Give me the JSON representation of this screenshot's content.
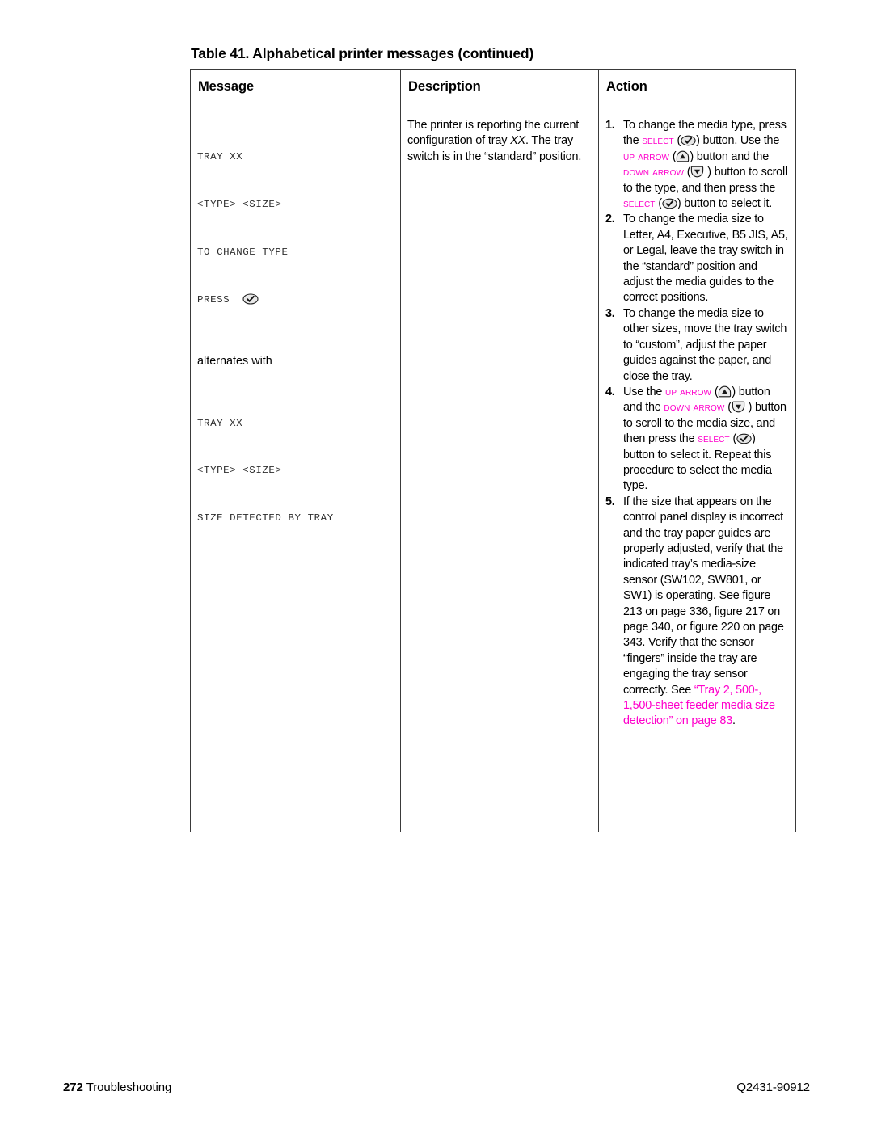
{
  "table": {
    "caption": "Table 41. Alphabetical printer messages (continued)",
    "headers": {
      "message": "Message",
      "description": "Description",
      "action": "Action"
    },
    "row": {
      "message": {
        "block1": [
          "TRAY XX",
          "<TYPE> <SIZE>",
          "TO CHANGE TYPE"
        ],
        "press_label": "PRESS",
        "alternates_label": "alternates with",
        "block2": [
          "TRAY XX",
          "<TYPE> <SIZE>",
          "SIZE DETECTED BY TRAY"
        ]
      },
      "description": {
        "part1": "The printer is reporting the current configuration of tray ",
        "tray_var": "XX",
        "part2": ". The tray switch is in the “standard” position."
      },
      "action": {
        "steps": [
          {
            "num": "1.",
            "seg": [
              "To change the media type, press the ",
              "Select",
              " (",
              "select-icon",
              ") button. Use the ",
              "Up Arrow",
              " (",
              "up-arrow-icon",
              ") button and the ",
              "Down Arrow",
              " (",
              "down-arrow-icon",
              " ) button to scroll to the type, and then press the ",
              "Select",
              " (",
              "select-icon",
              ") button to select it."
            ]
          },
          {
            "num": "2.",
            "text": "To change the media size to Letter, A4, Executive, B5 JIS, A5, or Legal, leave the tray switch in the “standard” position and adjust the media guides to the correct positions."
          },
          {
            "num": "3.",
            "text": "To change the media size to other sizes, move the tray switch to “custom”, adjust the paper guides against the paper, and close the tray."
          },
          {
            "num": "4.",
            "seg": [
              "Use the ",
              "Up Arrow",
              " (",
              "up-arrow-icon",
              ") button and the ",
              "Down Arrow",
              " (",
              "down-arrow-icon",
              " ) button to scroll to the media size, and then press the ",
              "Select",
              " (",
              "select-icon",
              ") button to select it. Repeat this procedure to select the media type."
            ]
          },
          {
            "num": "5.",
            "text_before": "If the size that appears on the control panel display is incorrect and the tray paper guides are properly adjusted, verify that the indicated tray’s media-size sensor (SW102, SW801, or SW1) is operating. See figure 213 on page 336, figure 217 on page 340, or figure 220 on page 343. Verify that the sensor “fingers” inside the tray are engaging the tray sensor correctly. See ",
            "link": "“Tray 2, 500-, 1,500-sheet feeder media size detection” on page 83",
            "text_after": "."
          }
        ]
      }
    }
  },
  "footer": {
    "page_number": "272",
    "section": "Troubleshooting",
    "part_number": "Q2431-90912"
  },
  "colors": {
    "keyword_pink": "#ff00cc",
    "link_pink": "#ff00cc",
    "border": "#3a3a3a",
    "mono_text": "#2c2c2c"
  }
}
